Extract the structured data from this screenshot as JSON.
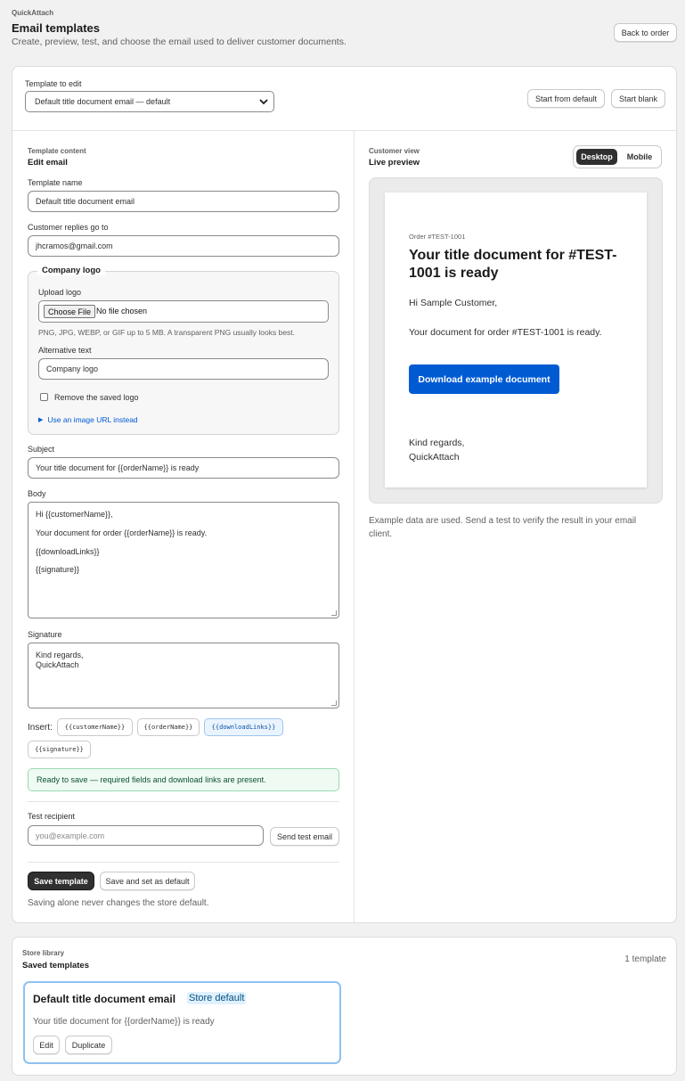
{
  "header": {
    "app_name": "QuickAttach",
    "title": "Email templates",
    "subtitle": "Create, preview, test, and choose the email used to deliver customer documents.",
    "back_label": "Back to order"
  },
  "template_picker": {
    "label": "Template to edit",
    "selected": "Default title document email — default",
    "start_default_label": "Start from default",
    "start_blank_label": "Start blank"
  },
  "editor": {
    "caption": "Template content",
    "heading": "Edit email",
    "name_label": "Template name",
    "name_value": "Default title document email",
    "replies_label": "Customer replies go to",
    "replies_value": "jhcramos@gmail.com",
    "logo": {
      "legend": "Company logo",
      "upload_label": "Upload logo",
      "choose_file_label": "Choose File",
      "no_file_text": "No file chosen",
      "help": "PNG, JPG, WEBP, or GIF up to 5 MB. A transparent PNG usually looks best.",
      "alt_label": "Alternative text",
      "alt_value": "Company logo",
      "remove_label": "Remove the saved logo",
      "url_toggle": "Use an image URL instead"
    },
    "subject_label": "Subject",
    "subject_value": "Your title document for {{orderName}} is ready",
    "body_label": "Body",
    "body_lines": [
      "Hi {{customerName}},",
      "Your document for order {{orderName}} is ready.",
      "{{downloadLinks}}",
      "{{signature}}"
    ],
    "signature_label": "Signature",
    "signature_lines": [
      "Kind regards,",
      "QuickAttach"
    ],
    "insert_label": "Insert:",
    "tokens": [
      "{{customerName}}",
      "{{orderName}}",
      "{{downloadLinks}}",
      "{{signature}}"
    ],
    "status_message": "Ready to save — required fields and download links are present.",
    "test_label": "Test recipient",
    "test_placeholder": "you@example.com",
    "send_test_label": "Send test email",
    "save_label": "Save template",
    "save_default_label": "Save and set as default",
    "save_note": "Saving alone never changes the store default."
  },
  "preview": {
    "caption": "Customer view",
    "heading": "Live preview",
    "desktop_label": "Desktop",
    "mobile_label": "Mobile",
    "order_tag": "Order #TEST-1001",
    "email_title_line1": "Your title document for #TEST-",
    "email_title_line2": "1001 is ready",
    "greeting": "Hi Sample Customer,",
    "message": "Your document for order #TEST-1001 is ready.",
    "download_label": "Download example document",
    "sign_line1": "Kind regards,",
    "sign_line2": "QuickAttach",
    "note_line1": "Example data are used. Send a test to verify the result in your email",
    "note_line2": "client."
  },
  "library": {
    "caption": "Store library",
    "heading": "Saved templates",
    "count": "1 template",
    "item": {
      "name": "Default title document email",
      "badge": "Store default",
      "subject": "Your title document for {{orderName}} is ready",
      "edit_label": "Edit",
      "duplicate_label": "Duplicate"
    }
  },
  "colors": {
    "accent": "#005bd3",
    "status_bg": "#eefaf2",
    "status_border": "#9ad9b3",
    "status_text": "#0c5132"
  }
}
